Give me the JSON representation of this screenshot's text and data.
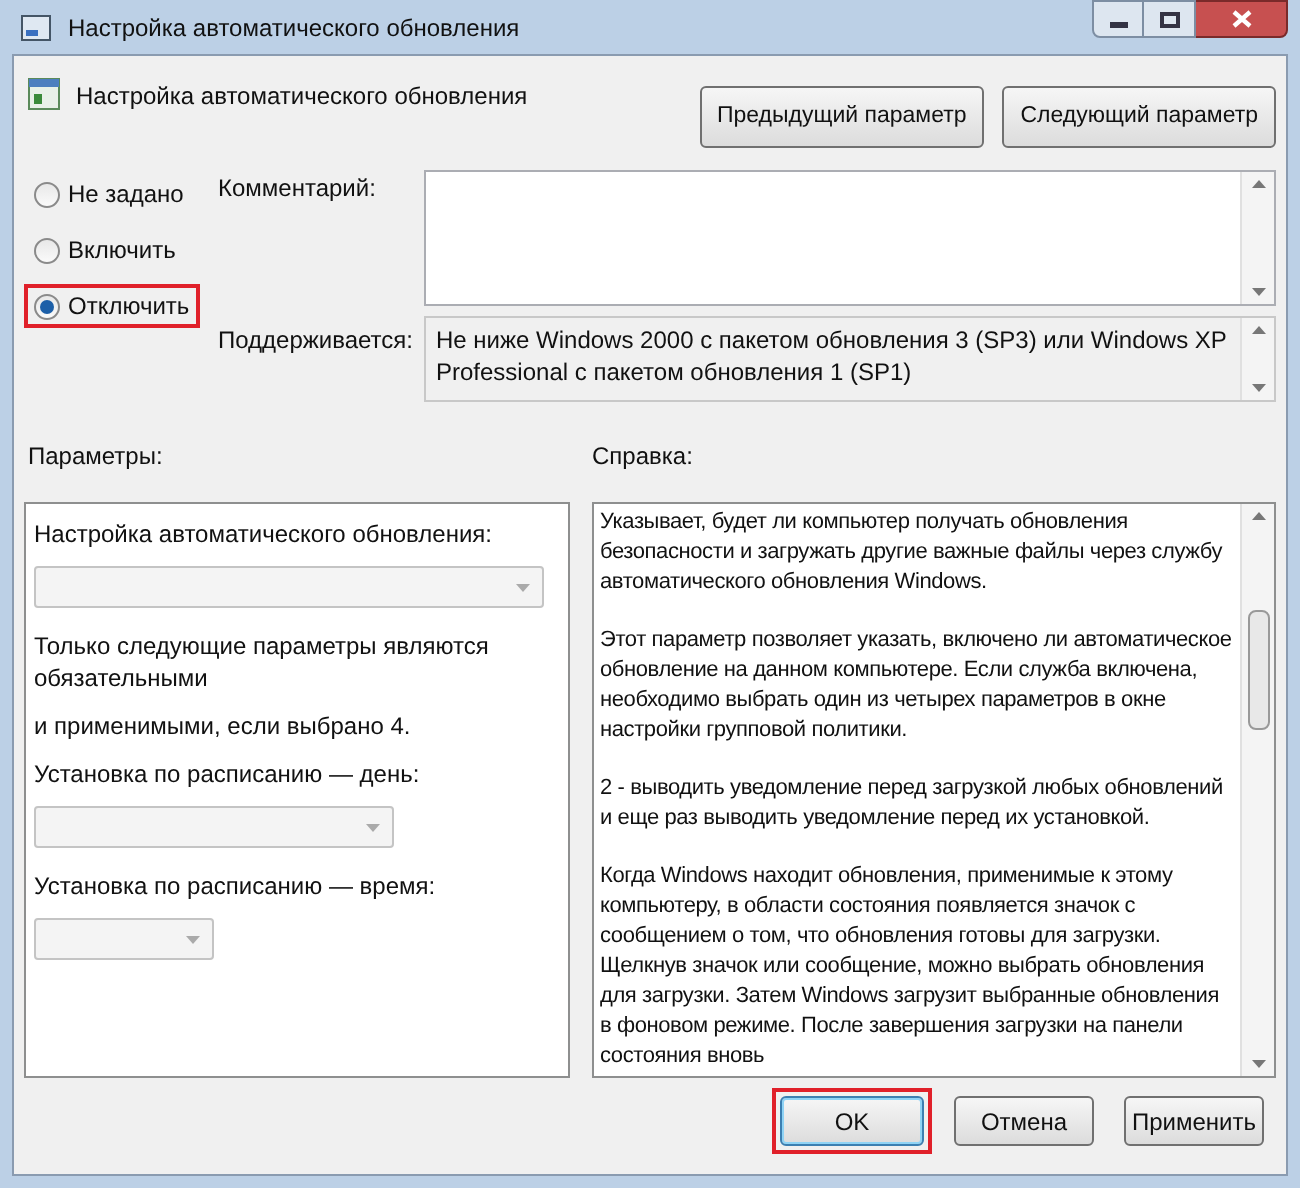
{
  "window": {
    "title": "Настройка автоматического обновления"
  },
  "header": {
    "title": "Настройка автоматического обновления",
    "buttons": [
      {
        "label": "Предыдущий параметр"
      },
      {
        "label": "Следующий параметр"
      }
    ]
  },
  "state_options": [
    {
      "label": "Не задано",
      "selected": false,
      "highlighted": false
    },
    {
      "label": "Включить",
      "selected": false,
      "highlighted": false
    },
    {
      "label": "Отключить",
      "selected": true,
      "highlighted": true
    }
  ],
  "comment": {
    "label": "Комментарий:"
  },
  "supported": {
    "label": "Поддерживается:",
    "value": "Не ниже Windows 2000 с пакетом обновления 3 (SP3) или Windows XP Professional с пакетом обновления 1 (SP1)"
  },
  "options_panel": {
    "label": "Параметры:",
    "items": [
      {
        "kind": "label",
        "text": "Настройка автоматического обновления:"
      },
      {
        "kind": "dropdown",
        "disabled": true
      },
      {
        "kind": "label",
        "text": "Только следующие параметры являются обязательными"
      },
      {
        "kind": "label",
        "text": "и применимыми, если выбрано 4."
      },
      {
        "kind": "label",
        "text": "Установка по расписанию — день:"
      },
      {
        "kind": "dropdown",
        "disabled": true
      },
      {
        "kind": "label",
        "text": "Установка по расписанию — время:"
      },
      {
        "kind": "dropdown",
        "disabled": true
      }
    ]
  },
  "help_panel": {
    "label": "Справка:",
    "paragraphs": [
      "Указывает, будет ли компьютер получать обновления безопасности и загружать другие важные файлы через службу автоматического обновления Windows.",
      "Этот параметр позволяет указать, включено ли автоматическое обновление на данном компьютере. Если служба включена, необходимо выбрать один из четырех параметров в окне настройки групповой политики.",
      "2 - выводить уведомление перед загрузкой любых обновлений и еще раз выводить уведомление перед их установкой.",
      "Когда Windows находит обновления, применимые к этому компьютеру, в области состояния появляется значок с сообщением о том, что обновления готовы для загрузки. Щелкнув значок или сообщение, можно выбрать обновления для загрузки. Затем Windows загрузит выбранные обновления в фоновом режиме. После завершения загрузки на панели состояния вновь"
    ]
  },
  "footer_buttons": [
    {
      "label": "OK",
      "highlighted": true,
      "default": true
    },
    {
      "label": "Отмена",
      "highlighted": false,
      "default": false
    },
    {
      "label": "Применить",
      "highlighted": false,
      "default": false
    }
  ]
}
